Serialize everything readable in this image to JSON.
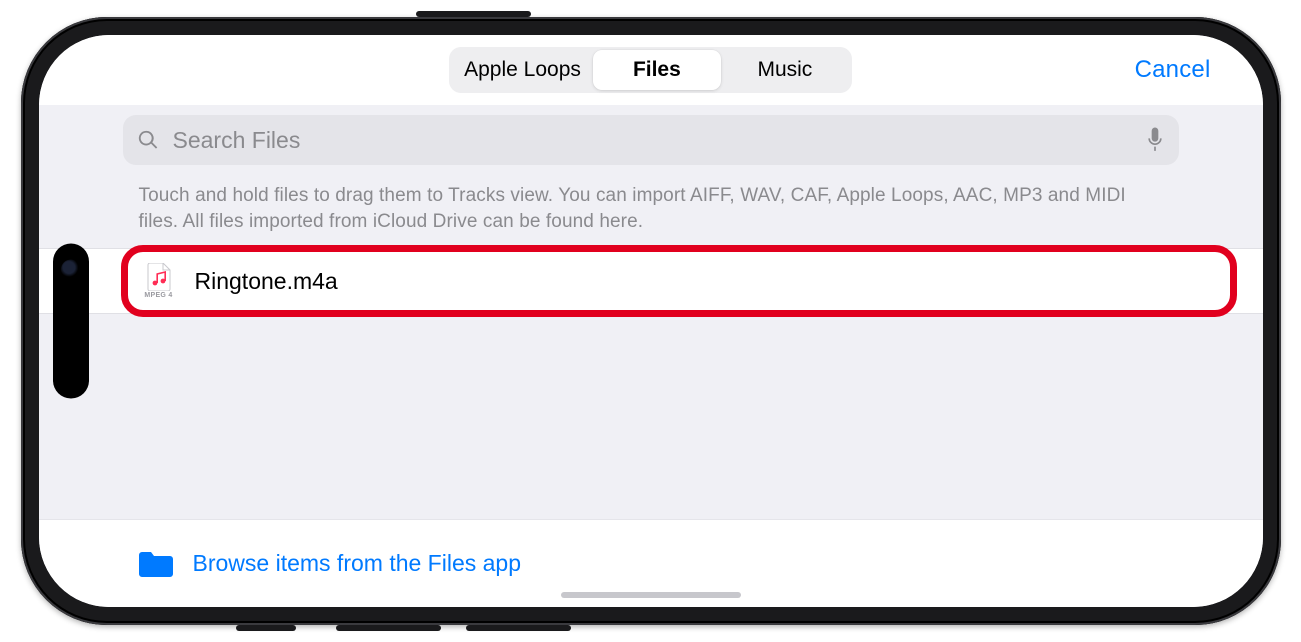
{
  "header": {
    "tabs": [
      {
        "label": "Apple Loops",
        "selected": false
      },
      {
        "label": "Files",
        "selected": true
      },
      {
        "label": "Music",
        "selected": false
      }
    ],
    "cancel": "Cancel"
  },
  "search": {
    "placeholder": "Search Files",
    "value": ""
  },
  "hint": "Touch and hold files to drag them to Tracks view. You can import AIFF, WAV, CAF, Apple Loops, AAC, MP3 and MIDI files. All files imported from iCloud Drive can be found here.",
  "files": [
    {
      "name": "Ringtone.m4a",
      "ext_label": "MPEG 4",
      "highlighted": true
    }
  ],
  "browse": {
    "label": "Browse items from the Files app"
  },
  "colors": {
    "accent": "#007aff",
    "highlight": "#e1001e"
  }
}
